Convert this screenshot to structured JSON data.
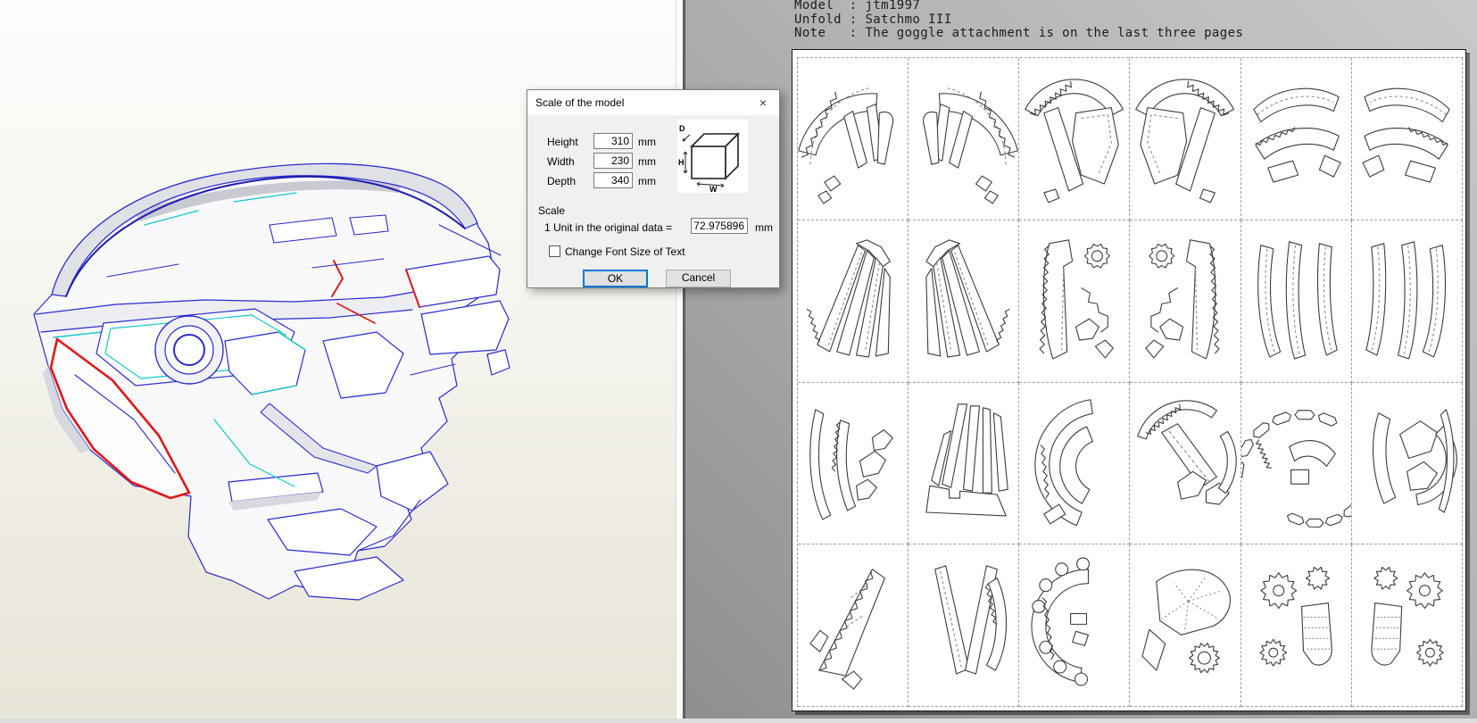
{
  "dialog": {
    "title": "Scale of the model",
    "close_glyph": "×",
    "fields": [
      {
        "label": "Height",
        "value": "310",
        "unit": "mm"
      },
      {
        "label": "Width",
        "value": "230",
        "unit": "mm"
      },
      {
        "label": "Depth",
        "value": "340",
        "unit": "mm"
      }
    ],
    "cube": {
      "d": "D",
      "h": "H",
      "w": "W"
    },
    "scale_caption": "Scale",
    "scale_label": "1 Unit in the original data =",
    "scale_value": "72.975896",
    "scale_unit": "mm",
    "checkbox_label": "Change Font Size of Text",
    "checkbox_checked": false,
    "ok_label": "OK",
    "cancel_label": "Cancel"
  },
  "pattern_panel": {
    "info_lines": [
      "Model  : jtm1997",
      "Unfold : Satchmo III",
      "Note   : The goggle attachment is on the last three pages"
    ],
    "grid": {
      "rows": 4,
      "cols": 6
    }
  },
  "colors": {
    "edge_blue": "#2a2acf",
    "edge_cyan": "#12c8c8",
    "edge_red": "#de1818",
    "ok_focus_border": "#0078d7",
    "pattern_stroke": "#3b3b3b"
  }
}
